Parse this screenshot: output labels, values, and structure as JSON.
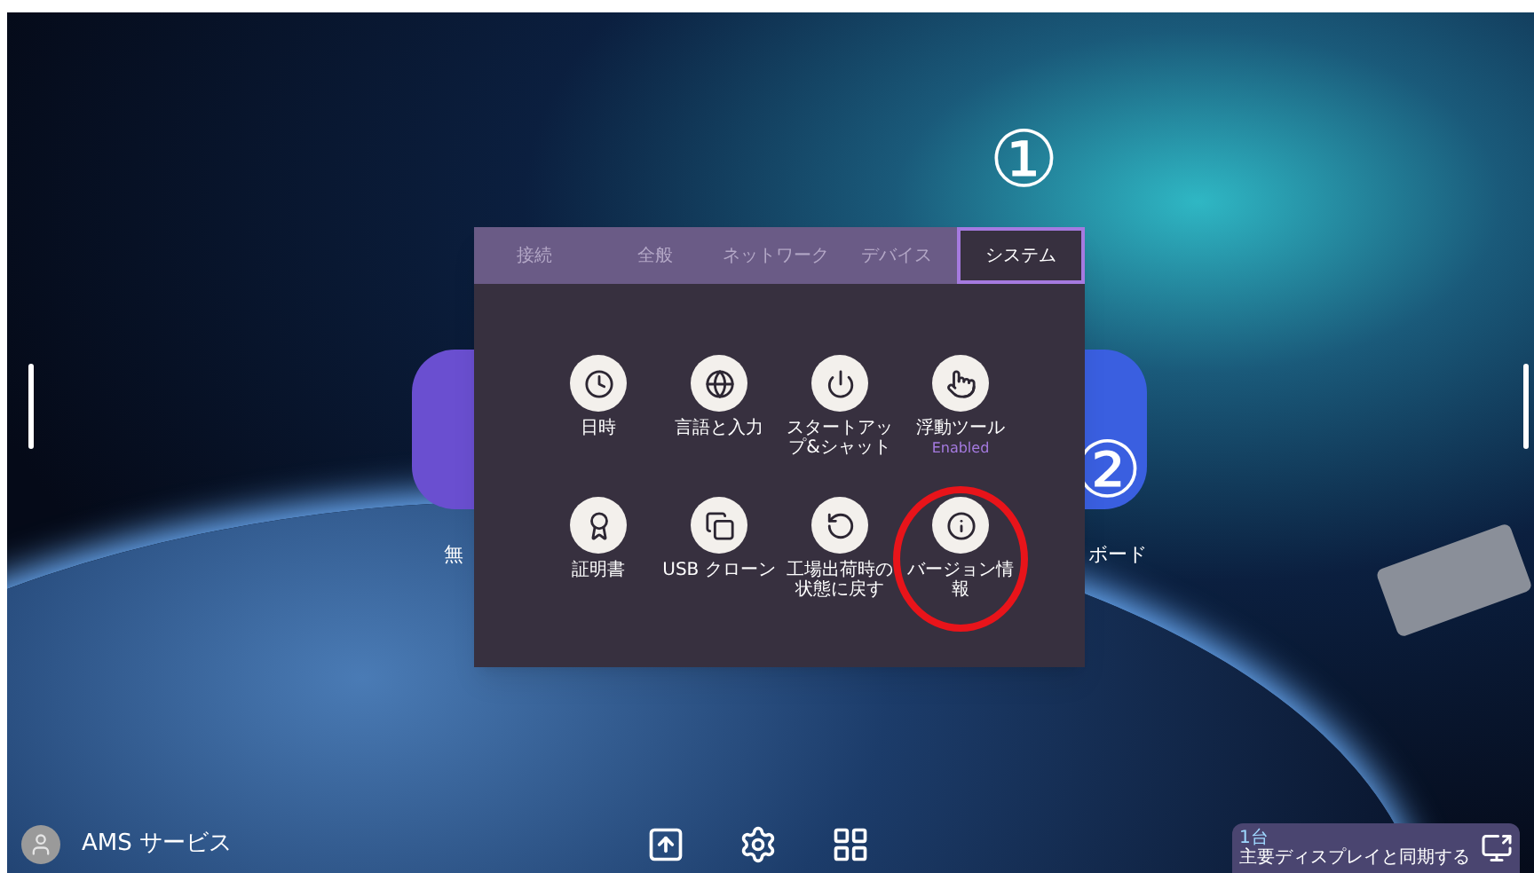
{
  "annotations": [
    {
      "label": "①"
    },
    {
      "label": "②"
    }
  ],
  "background_apps": [
    {
      "label": "無",
      "color": "#6a4fd0"
    },
    {
      "label": "ボード",
      "color": "#3a5fe0"
    }
  ],
  "dialog": {
    "tabs": [
      {
        "label": "接続",
        "selected": false
      },
      {
        "label": "全般",
        "selected": false
      },
      {
        "label": "ネットワーク",
        "selected": false
      },
      {
        "label": "デバイス",
        "selected": false
      },
      {
        "label": "システム",
        "selected": true
      }
    ],
    "items": [
      {
        "kind": "clock",
        "label": "日時",
        "circled": false
      },
      {
        "kind": "globe",
        "label": "言語と入力",
        "circled": false
      },
      {
        "kind": "power",
        "label": "スタートアップ&シャット",
        "circled": false
      },
      {
        "kind": "touch",
        "label": "浮動ツール",
        "status": "Enabled",
        "circled": false
      },
      {
        "kind": "award",
        "label": "証明書",
        "circled": false
      },
      {
        "kind": "copy",
        "label": "USB クローン",
        "circled": false
      },
      {
        "kind": "reset",
        "label": "工場出荷時の状態に戻す",
        "circled": false
      },
      {
        "kind": "info",
        "label": "バージョン情報",
        "circled": true
      }
    ]
  },
  "bottom_bar": {
    "user": "AMS サービス",
    "sync": {
      "count": "1台",
      "label": "主要ディスプレイと同期する"
    }
  }
}
